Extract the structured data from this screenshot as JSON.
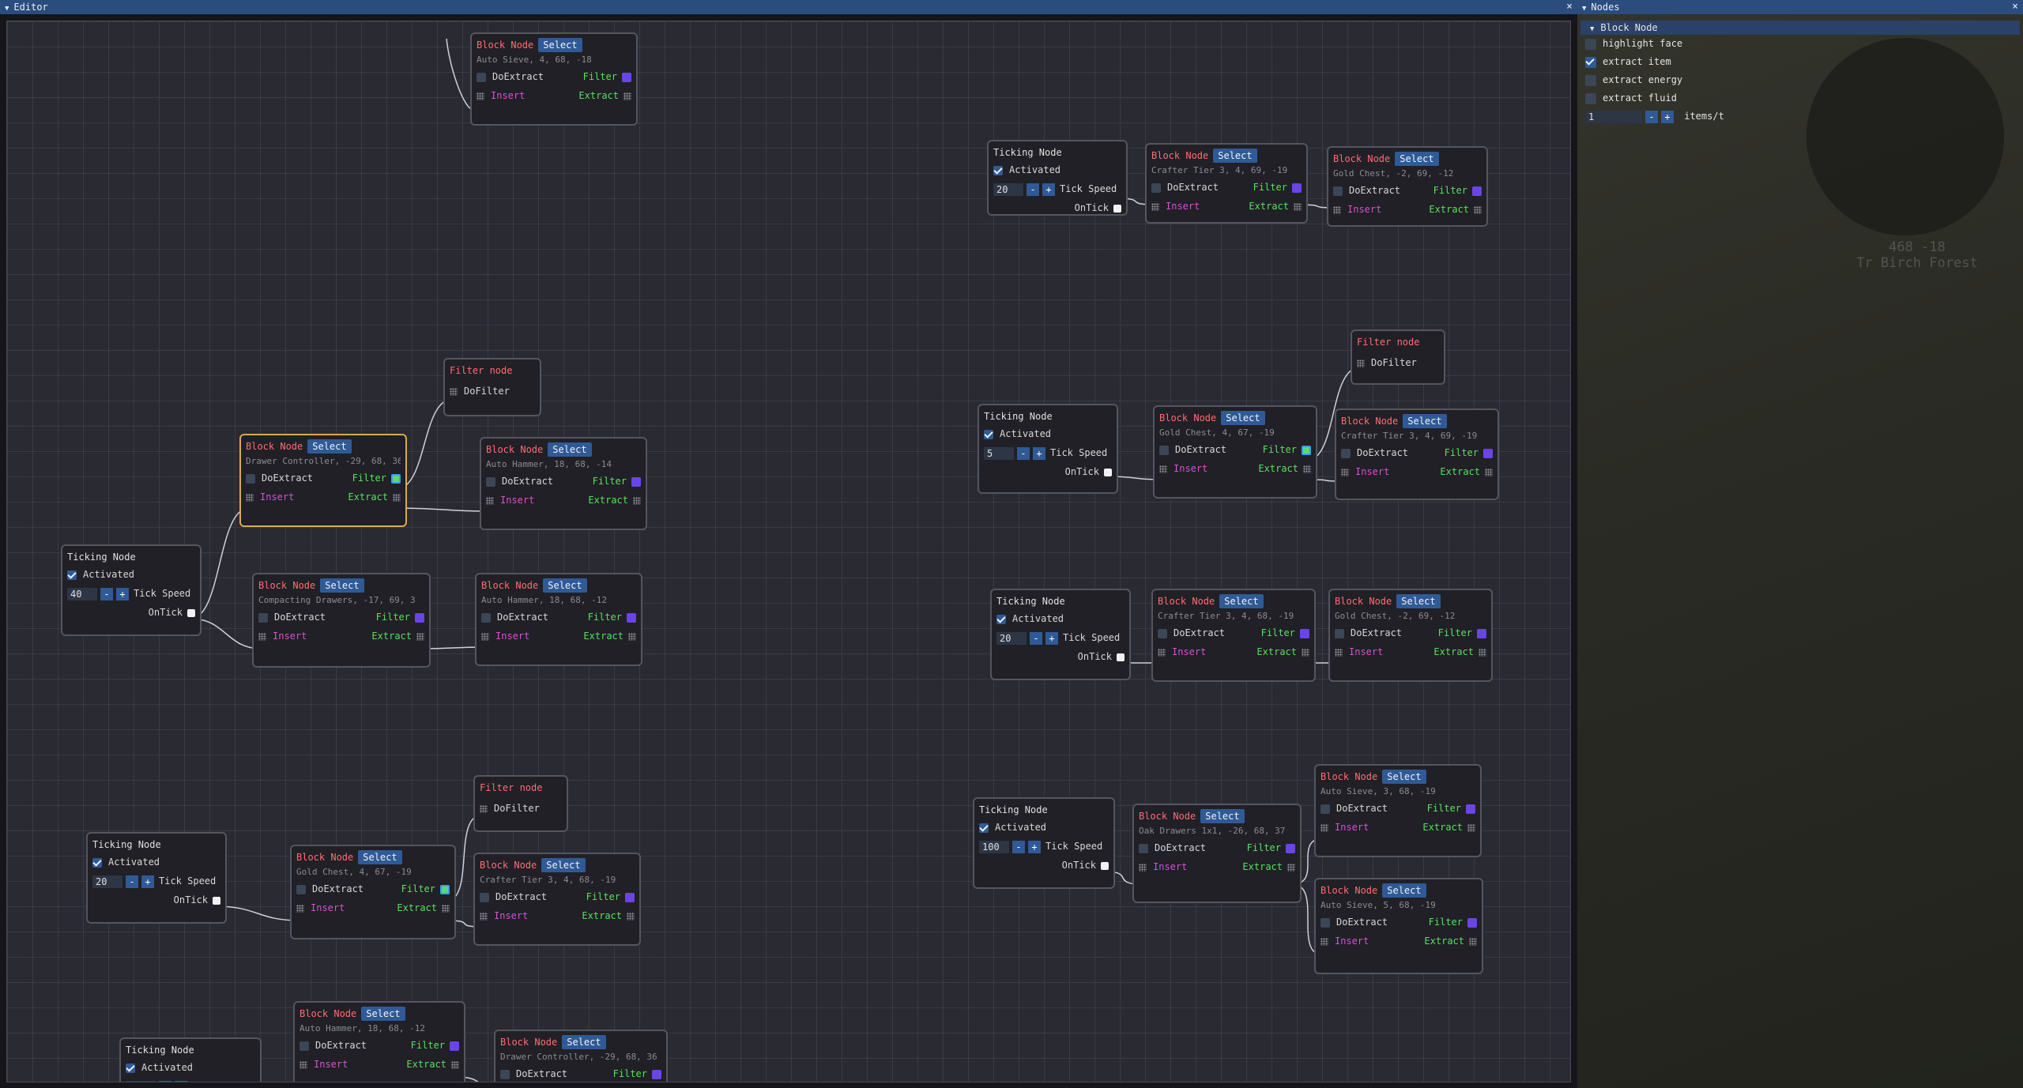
{
  "editor": {
    "title": "Editor",
    "close": "×"
  },
  "panel": {
    "title": "Nodes",
    "close": "×",
    "section": "Block Node",
    "options": [
      {
        "label": "highlight face",
        "checked": false
      },
      {
        "label": "extract item",
        "checked": true
      },
      {
        "label": "extract energy",
        "checked": false
      },
      {
        "label": "extract fluid",
        "checked": false
      }
    ],
    "rate": {
      "value": "1",
      "minus": "-",
      "plus": "+",
      "unit": "items/t"
    },
    "background_faint": {
      "coords": "468 -18",
      "biome": "Tr Birch Forest"
    }
  },
  "labels": {
    "block": "Block Node",
    "filter": "Filter node",
    "ticking": "Ticking Node",
    "select": "Select",
    "doextract": "DoExtract",
    "filter_pin": "Filter",
    "insert": "Insert",
    "extract": "Extract",
    "dofilter": "DoFilter",
    "activated": "Activated",
    "tickspeed": "Tick Speed",
    "ontick": "OnTick",
    "minus": "-",
    "plus": "+"
  },
  "nodes": [
    {
      "type": "block",
      "sub": "Auto Sieve, 4, 68, -18",
      "filter_color": "purple"
    },
    {
      "type": "ticking",
      "speed": "20"
    },
    {
      "type": "block",
      "sub": "Crafter Tier 3, 4, 69, -19",
      "filter_color": "purple"
    },
    {
      "type": "block",
      "sub": "Gold Chest, -2, 69, -12",
      "filter_color": "purple"
    },
    {
      "type": "filter"
    },
    {
      "type": "block",
      "sub": "Drawer Controller, -29, 68, 36",
      "filter_color": "green",
      "selected": true
    },
    {
      "type": "block",
      "sub": "Auto Hammer, 18, 68, -14",
      "filter_color": "purple"
    },
    {
      "type": "ticking",
      "speed": "40"
    },
    {
      "type": "block",
      "sub": "Compacting Drawers, -17, 69, 3",
      "filter_color": "purple"
    },
    {
      "type": "block",
      "sub": "Auto Hammer, 18, 68, -12",
      "filter_color": "purple"
    },
    {
      "type": "filter"
    },
    {
      "type": "ticking",
      "speed": "5"
    },
    {
      "type": "block",
      "sub": "Gold Chest, 4, 67, -19",
      "filter_color": "green"
    },
    {
      "type": "block",
      "sub": "Crafter Tier 3, 4, 69, -19",
      "filter_color": "purple"
    },
    {
      "type": "ticking",
      "speed": "20"
    },
    {
      "type": "block",
      "sub": "Crafter Tier 3, 4, 68, -19",
      "filter_color": "purple"
    },
    {
      "type": "block",
      "sub": "Gold Chest, -2, 69, -12",
      "filter_color": "purple"
    },
    {
      "type": "filter"
    },
    {
      "type": "ticking",
      "speed": "20"
    },
    {
      "type": "block",
      "sub": "Gold Chest, 4, 67, -19",
      "filter_color": "green"
    },
    {
      "type": "block",
      "sub": "Crafter Tier 3, 4, 68, -19",
      "filter_color": "purple"
    },
    {
      "type": "ticking",
      "speed": "100"
    },
    {
      "type": "block",
      "sub": "Oak Drawers 1x1, -26, 68, 37",
      "filter_color": "purple"
    },
    {
      "type": "block",
      "sub": "Auto Sieve, 3, 68, -19",
      "filter_color": "purple"
    },
    {
      "type": "block",
      "sub": "Auto Sieve, 5, 68, -19",
      "filter_color": "purple"
    },
    {
      "type": "ticking",
      "speed": ""
    },
    {
      "type": "block",
      "sub": "Auto Hammer, 18, 68, -12",
      "filter_color": "purple"
    },
    {
      "type": "block",
      "sub": "Drawer Controller, -29, 68, 36",
      "filter_color": "purple"
    }
  ]
}
